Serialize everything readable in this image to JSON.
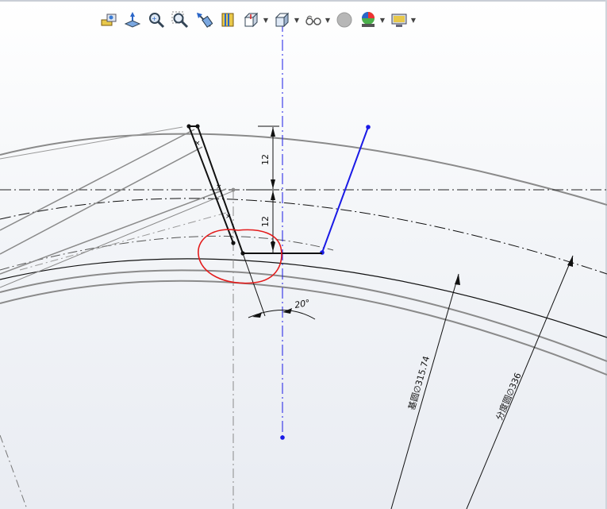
{
  "toolbar": {
    "tools": [
      {
        "name": "zoom-to-fit-icon",
        "has_dropdown": false
      },
      {
        "name": "normal-to-icon",
        "has_dropdown": false
      },
      {
        "name": "zoom-to-area-icon",
        "has_dropdown": false
      },
      {
        "name": "zoom-in-out-icon",
        "has_dropdown": false
      },
      {
        "name": "previous-view-icon",
        "has_dropdown": false
      },
      {
        "name": "section-view-icon",
        "has_dropdown": false
      },
      {
        "name": "view-orientation-icon",
        "has_dropdown": true
      },
      {
        "name": "display-style-icon",
        "has_dropdown": true
      },
      {
        "name": "hide-show-items-icon",
        "has_dropdown": true
      },
      {
        "name": "edit-appearance-icon",
        "has_dropdown": false
      },
      {
        "name": "apply-scene-icon",
        "has_dropdown": true
      },
      {
        "name": "view-settings-icon",
        "has_dropdown": true
      }
    ]
  },
  "sketch": {
    "dim_upper": "12",
    "dim_lower": "12",
    "angle_dim": "20°",
    "base_circle_label": "基圆∅315.74",
    "pitch_circle_label": "分度圆∅336"
  },
  "colors": {
    "sketch_black": "#111111",
    "construction_blue": "#1a1ae6",
    "edge_gray": "#7a7a7a",
    "markup_red": "#e31b1b"
  }
}
